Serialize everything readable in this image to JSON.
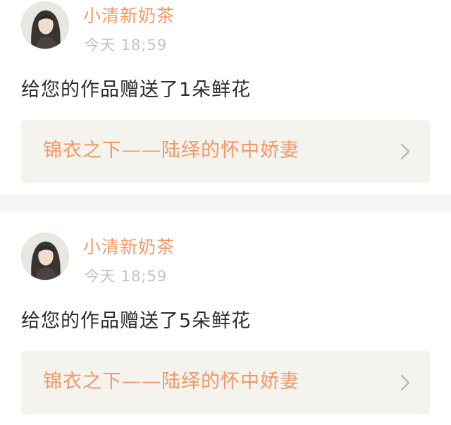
{
  "colors": {
    "accent": "#f29866",
    "timestamp": "#c3c3c3",
    "message": "#2c2c2c",
    "card_background": "#f4f3ee",
    "divider": "#f5f5f3"
  },
  "entries": [
    {
      "avatar_icon": "user-avatar",
      "username": "小清新奶茶",
      "timestamp": "今天 18;59",
      "message": "给您的作品赠送了1朵鲜花",
      "book_title": "锦衣之下——陆绎的怀中娇妻",
      "chevron_icon": "chevron-right-icon"
    },
    {
      "avatar_icon": "user-avatar",
      "username": "小清新奶茶",
      "timestamp": "今天 18;59",
      "message": "给您的作品赠送了5朵鲜花",
      "book_title": "锦衣之下——陆绎的怀中娇妻",
      "chevron_icon": "chevron-right-icon"
    }
  ]
}
